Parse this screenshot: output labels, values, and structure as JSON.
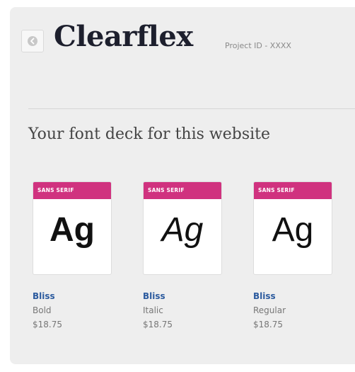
{
  "header": {
    "back_icon": "back-arrow-icon",
    "title": "Clearflex",
    "project_id": "Project ID - XXXX"
  },
  "section": {
    "title": "Your font deck for this website"
  },
  "cards": [
    {
      "category": "SANS SERIF",
      "sample": "Ag",
      "name": "Bliss",
      "style": "Bold",
      "price": "$18.75"
    },
    {
      "category": "SANS SERIF",
      "sample": "Ag",
      "name": "Bliss",
      "style": "Italic",
      "price": "$18.75"
    },
    {
      "category": "SANS SERIF",
      "sample": "Ag",
      "name": "Bliss",
      "style": "Regular",
      "price": "$18.75"
    }
  ],
  "colors": {
    "badge": "#d0327f",
    "link": "#2b5a9e",
    "title": "#1d1f2d",
    "panel": "#eeeeee"
  }
}
